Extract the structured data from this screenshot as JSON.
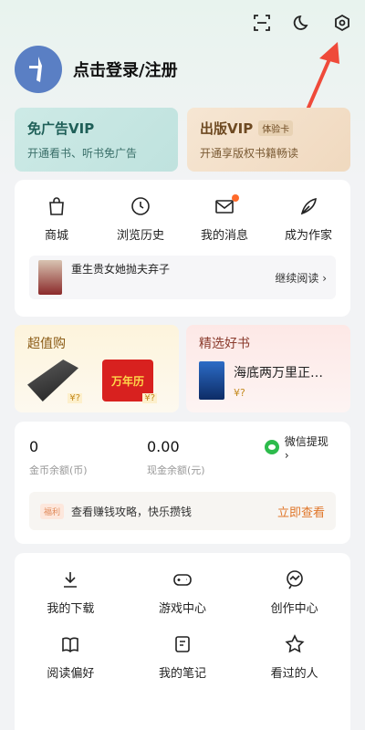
{
  "topbar": {
    "icons": [
      "scan-icon",
      "moon-icon",
      "settings-icon"
    ]
  },
  "profile": {
    "login_label": "点击登录/注册"
  },
  "vip": {
    "ad": {
      "title": "免广告VIP",
      "subtitle": "开通看书、听书免广告"
    },
    "publish": {
      "title": "出版VIP",
      "tag": "体验卡",
      "subtitle": "开通享版权书籍畅读"
    }
  },
  "quick": [
    {
      "label": "商城"
    },
    {
      "label": "浏览历史"
    },
    {
      "label": "我的消息"
    },
    {
      "label": "成为作家"
    }
  ],
  "recent": {
    "book_title": "重生贵女她抛夫弃子",
    "continue_label": "继续阅读 ›"
  },
  "promo": {
    "deals_title": "超值购",
    "deal_price": "¥?",
    "calendar_label": "万年历",
    "picks_title": "精选好书",
    "pick_book": "海底两万里正…",
    "pick_price": "¥?"
  },
  "balance": {
    "coins": "0",
    "coins_label": "金币余额(币)",
    "cash": "0.00",
    "cash_label": "现金余额(元)",
    "withdraw_label": "微信提现 ›"
  },
  "welfare": {
    "badge": "福利",
    "text": "查看赚钱攻略，快乐攒钱",
    "action": "立即查看"
  },
  "services": [
    {
      "label": "我的下载"
    },
    {
      "label": "游戏中心"
    },
    {
      "label": "创作中心"
    },
    {
      "label": "阅读偏好"
    },
    {
      "label": "我的笔记"
    },
    {
      "label": "看过的人"
    }
  ],
  "colors": {
    "accent": "#e0762a",
    "arrow": "#ef4a3a",
    "wechat": "#2dbb4c"
  }
}
